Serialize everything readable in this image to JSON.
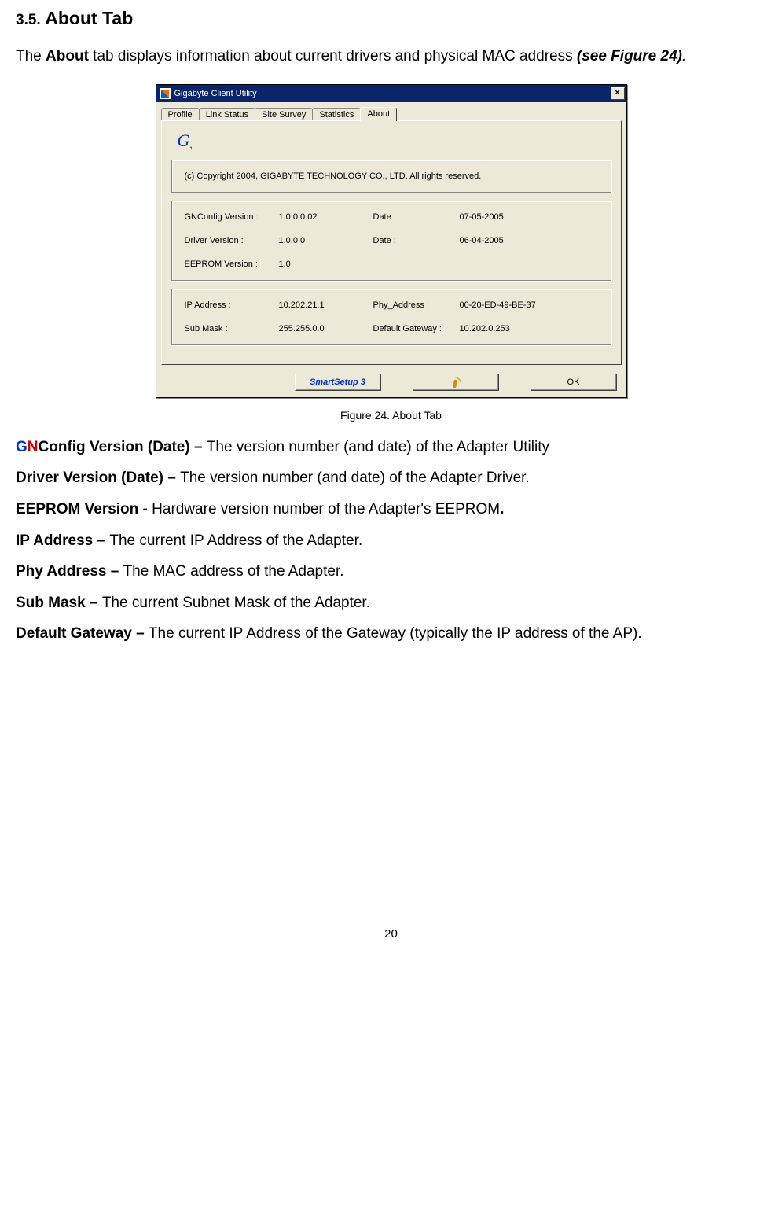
{
  "heading": {
    "number": "3.5.",
    "title": "About Tab"
  },
  "intro": {
    "pre": "The ",
    "bold1": "About",
    "mid": " tab displays information about current drivers and physical MAC address ",
    "ref": "(see Figure 24)",
    "end": "."
  },
  "dialog": {
    "title": "Gigabyte Client Utility",
    "close": "×",
    "tabs": [
      "Profile",
      "Link Status",
      "Site Survey",
      "Statistics",
      "About"
    ],
    "active_tab": "About",
    "copyright": "(c) Copyright 2004, GIGABYTE TECHNOLOGY CO., LTD.  All rights reserved.",
    "group1": {
      "r1": {
        "label": "GNConfig Version :",
        "value": "1.0.0.0.02",
        "date_label": "Date :",
        "date_value": "07-05-2005"
      },
      "r2": {
        "label": "Driver Version :",
        "value": "1.0.0.0",
        "date_label": "Date :",
        "date_value": "06-04-2005"
      },
      "r3": {
        "label": "EEPROM Version :",
        "value": "1.0",
        "date_label": "",
        "date_value": ""
      }
    },
    "group2": {
      "r1": {
        "label": "IP Address :",
        "value": "10.202.21.1",
        "label2": "Phy_Address :",
        "value2": "00-20-ED-49-BE-37"
      },
      "r2": {
        "label": "Sub Mask :",
        "value": "255.255.0.0",
        "label2": "Default Gateway :",
        "value2": "10.202.0.253"
      }
    },
    "buttons": {
      "smartsetup": "SmartSetup 3",
      "ok": "OK"
    }
  },
  "caption": "Figure 24.    About Tab",
  "descriptions": {
    "d1": {
      "g": "G",
      "n": "N",
      "rest_bold": "Config Version (Date) – ",
      "text": "The version number (and date) of the Adapter Utility"
    },
    "d2": {
      "bold": "Driver Version (Date) – ",
      "text": "The version number (and date) of the Adapter Driver."
    },
    "d3": {
      "bold": "EEPROM Version - ",
      "text": "Hardware version number of the Adapter's EEPROM",
      "bold_end": "."
    },
    "d4": {
      "bold": "IP Address – ",
      "text": "The current IP Address of the Adapter."
    },
    "d5": {
      "bold": "Phy Address – ",
      "text": "The MAC address of the Adapter."
    },
    "d6": {
      "bold": "Sub Mask – ",
      "text": "The current Subnet Mask of the Adapter."
    },
    "d7": {
      "bold": "Default Gateway – ",
      "text": "The current IP Address of the Gateway (typically the IP address of the AP)."
    }
  },
  "page_number": "20"
}
